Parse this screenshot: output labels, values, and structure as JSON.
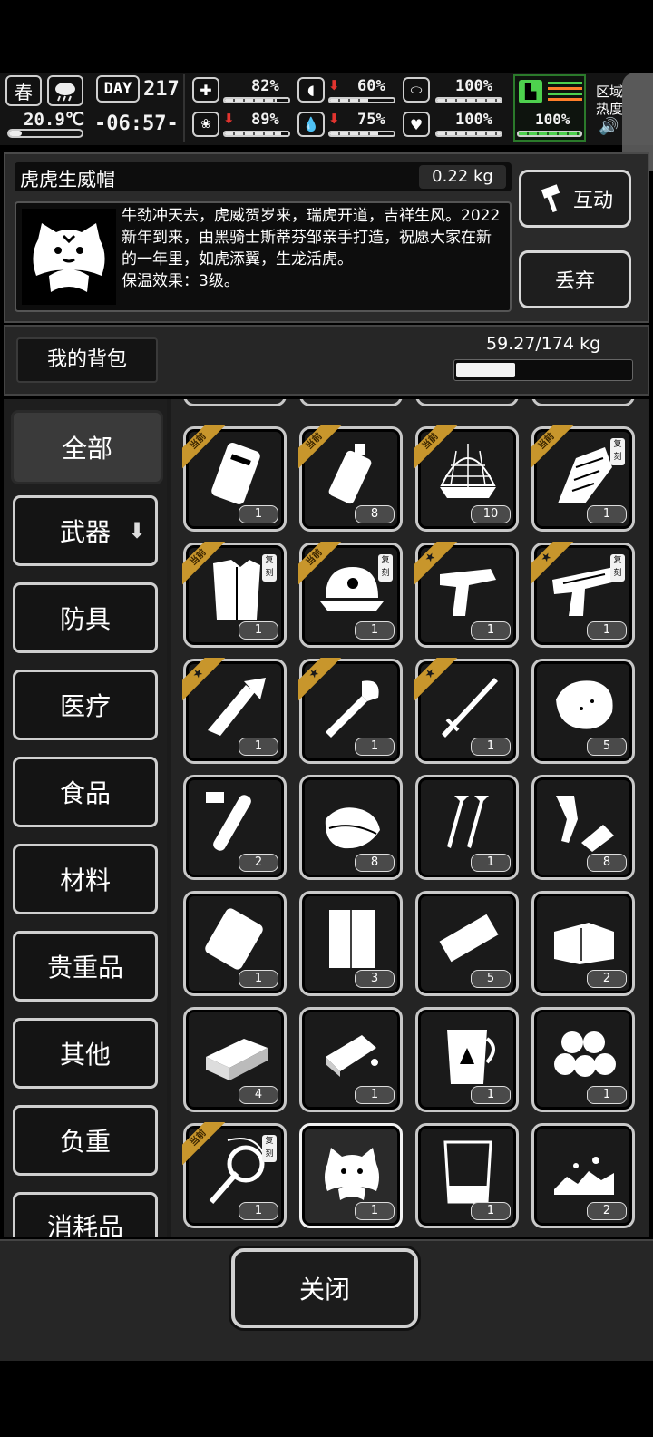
{
  "status": {
    "season": "春",
    "day_label": "DAY",
    "day_number": "217",
    "temperature": "20.9℃",
    "time": "-06:57-",
    "stats": [
      {
        "name": "health",
        "value": "82%",
        "level": 0.82,
        "arrow": false
      },
      {
        "name": "stomach",
        "value": "60%",
        "level": 0.6,
        "arrow": true
      },
      {
        "name": "armor",
        "value": "100%",
        "level": 1.0,
        "arrow": false
      },
      {
        "name": "brain",
        "value": "89%",
        "level": 0.89,
        "arrow": true
      },
      {
        "name": "water",
        "value": "75%",
        "level": 0.75,
        "arrow": true
      },
      {
        "name": "heart",
        "value": "100%",
        "level": 1.0,
        "arrow": false
      }
    ],
    "stamina_value": "100%",
    "stamina_level": 1.0,
    "zone_label_1": "区域",
    "zone_label_2": "热度"
  },
  "item": {
    "name": "虎虎生威帽",
    "weight": "0.22 kg",
    "description": "牛劲冲天去，虎威贺岁来，瑞虎开道，吉祥生风。2022新年到来，由黑骑士斯蒂芬邹亲手打造，祝愿大家在新的一年里，如虎添翼，生龙活虎。",
    "effect": "保温效果：3级。",
    "interact_label": "互动",
    "discard_label": "丢弃"
  },
  "backpack": {
    "title": "我的背包",
    "weight": "59.27/174 kg",
    "fill_fraction": 0.34
  },
  "categories": [
    "全部",
    "武器",
    "防具",
    "医疗",
    "食品",
    "材料",
    "贵重品",
    "其他",
    "负重",
    "消耗品"
  ],
  "ribbon_label": "当前",
  "replica_label": "复刻",
  "grid": [
    {
      "name": "armor-plate",
      "count": "1",
      "ribbon": "current"
    },
    {
      "name": "water-bottle",
      "count": "8",
      "ribbon": "current"
    },
    {
      "name": "net",
      "count": "10",
      "ribbon": "current"
    },
    {
      "name": "gloves",
      "count": "1",
      "ribbon": "current",
      "replica": true
    },
    {
      "name": "coat",
      "count": "1",
      "ribbon": "current",
      "replica": true
    },
    {
      "name": "cap",
      "count": "1",
      "ribbon": "current",
      "replica": true
    },
    {
      "name": "taser",
      "count": "1",
      "ribbon": "star"
    },
    {
      "name": "pistol",
      "count": "1",
      "ribbon": "star",
      "replica": true
    },
    {
      "name": "knife",
      "count": "1",
      "ribbon": "star"
    },
    {
      "name": "shovel",
      "count": "1",
      "ribbon": "star"
    },
    {
      "name": "katana",
      "count": "1",
      "ribbon": "star"
    },
    {
      "name": "meat",
      "count": "5"
    },
    {
      "name": "test-tube",
      "count": "2"
    },
    {
      "name": "cloth",
      "count": "8"
    },
    {
      "name": "screws",
      "count": "1"
    },
    {
      "name": "wire",
      "count": "8"
    },
    {
      "name": "bandage",
      "count": "1"
    },
    {
      "name": "paper",
      "count": "3"
    },
    {
      "name": "bar",
      "count": "5"
    },
    {
      "name": "sheet",
      "count": "2"
    },
    {
      "name": "brick",
      "count": "4"
    },
    {
      "name": "bread",
      "count": "1"
    },
    {
      "name": "jug",
      "count": "1"
    },
    {
      "name": "balls",
      "count": "1"
    },
    {
      "name": "whip",
      "count": "1",
      "ribbon": "current",
      "replica": true
    },
    {
      "name": "tiger-hat",
      "count": "1",
      "selected": true
    },
    {
      "name": "beaker",
      "count": "1"
    },
    {
      "name": "rubble",
      "count": "2"
    }
  ],
  "close_label": "关闭"
}
